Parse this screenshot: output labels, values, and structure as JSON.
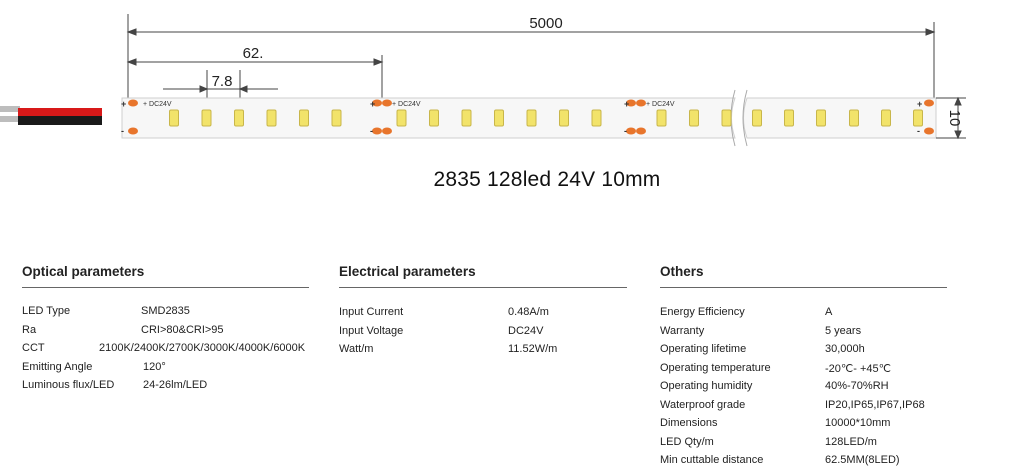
{
  "drawing": {
    "total_length": "5000",
    "segment_length": "62.",
    "pitch": "7.8",
    "width": "10",
    "pad_plus": "+",
    "pad_minus": "-",
    "voltage_mark": "DC24V",
    "led_color": "#f2e36a",
    "pad_color": "#e8752c",
    "wire_red": "#d81919",
    "wire_black": "#1a1a1a"
  },
  "title": "2835 128led 24V 10mm",
  "optical": {
    "heading": "Optical parameters",
    "rows": [
      {
        "label": "LED Type",
        "value": "SMD2835"
      },
      {
        "label": "Ra",
        "value": "CRI>80&CRI>95"
      },
      {
        "label": "CCT",
        "value": "2100K/2400K/2700K/3000K/4000K/6000K"
      },
      {
        "label": "Emitting Angle",
        "value": "120°"
      },
      {
        "label": "Luminous flux/LED",
        "value": "24-26lm/LED"
      }
    ]
  },
  "electrical": {
    "heading": "Electrical parameters",
    "rows": [
      {
        "label": "Input Current",
        "value": "0.48A/m"
      },
      {
        "label": "Input Voltage",
        "value": "DC24V"
      },
      {
        "label": "Watt/m",
        "value": "11.52W/m"
      }
    ]
  },
  "others": {
    "heading": "Others",
    "rows": [
      {
        "label": "Energy Efficiency",
        "value": "A"
      },
      {
        "label": "Warranty",
        "value": "5 years"
      },
      {
        "label": "Operating lifetime",
        "value": "30,000h"
      },
      {
        "label": "Operating temperature",
        "value": "-20℃- +45℃"
      },
      {
        "label": "Operating humidity",
        "value": "40%-70%RH"
      },
      {
        "label": "Waterproof grade",
        "value": "IP20,IP65,IP67,IP68"
      },
      {
        "label": "Dimensions",
        "value": "10000*10mm"
      },
      {
        "label": "LED Qty/m",
        "value": "128LED/m"
      },
      {
        "label": "Min cuttable distance",
        "value": "62.5MM(8LED)"
      }
    ]
  }
}
